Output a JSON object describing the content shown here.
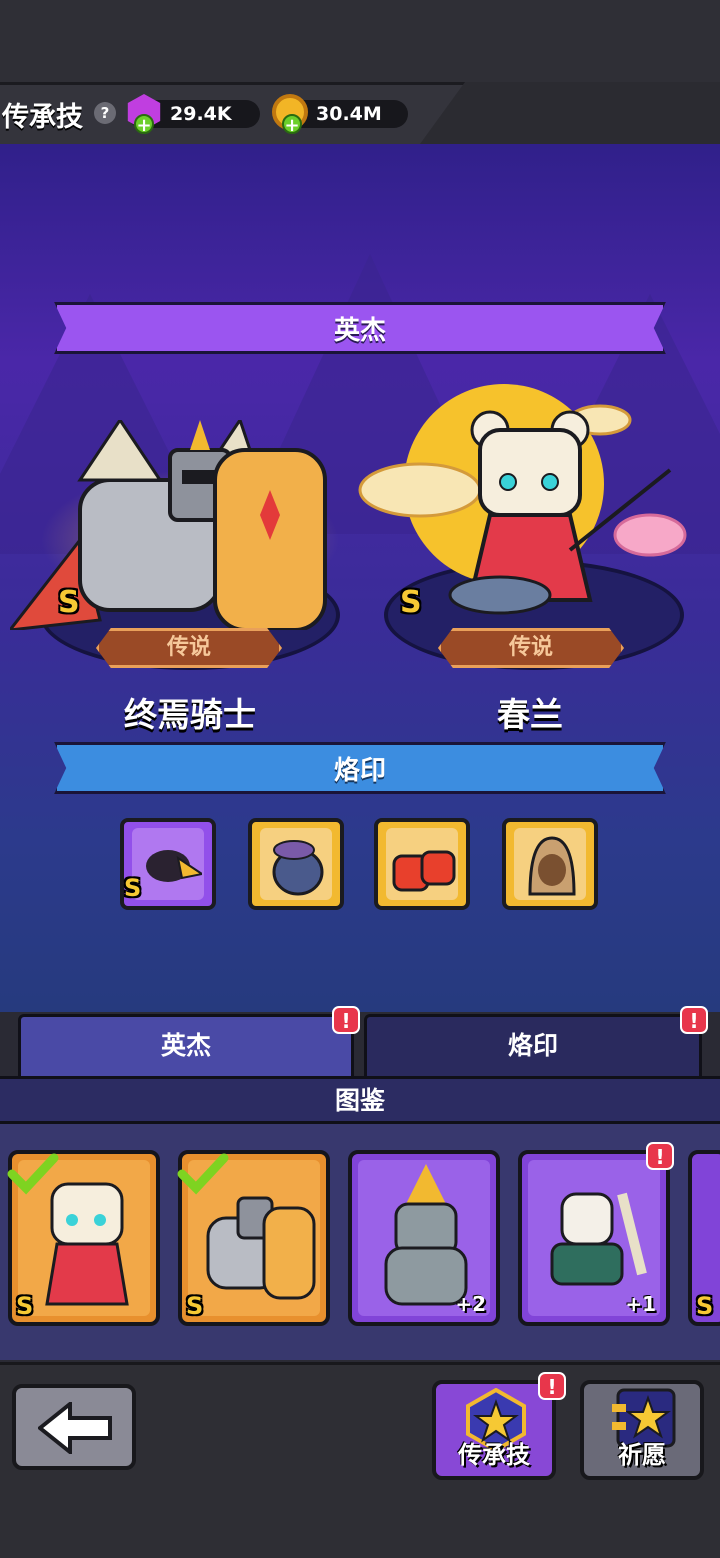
{
  "header": {
    "title": "传承技",
    "help_icon": "?",
    "gems": "29.4K",
    "coins": "30.4M"
  },
  "stage": {
    "heroes_banner": "英杰",
    "seals_banner": "烙印",
    "heroes": [
      {
        "name": "终焉骑士",
        "rank": "S",
        "rarity": "传说"
      },
      {
        "name": "春兰",
        "rank": "S",
        "rarity": "传说"
      }
    ],
    "seals": [
      {
        "rank": "S",
        "color": "purple"
      },
      {
        "rank": "",
        "color": "gold"
      },
      {
        "rank": "",
        "color": "gold"
      },
      {
        "rank": "",
        "color": "gold"
      }
    ]
  },
  "tabs": {
    "heroes": "英杰",
    "seals": "烙印",
    "alert": "!"
  },
  "codex": {
    "title": "图鉴",
    "cards": [
      {
        "rank": "S",
        "count": "",
        "checked": true
      },
      {
        "rank": "S",
        "count": "",
        "checked": true
      },
      {
        "rank": "",
        "count": "+2",
        "checked": false
      },
      {
        "rank": "",
        "count": "+1",
        "checked": false
      },
      {
        "rank": "S",
        "count": "",
        "checked": false
      }
    ]
  },
  "nav": {
    "inherit_label": "传承技",
    "wish_label": "祈愿",
    "alert": "!"
  },
  "colors": {
    "accent_purple": "#9b55f0",
    "accent_blue": "#3c8de0",
    "rank_gold": "#f6c934",
    "alert_red": "#e8364b"
  }
}
